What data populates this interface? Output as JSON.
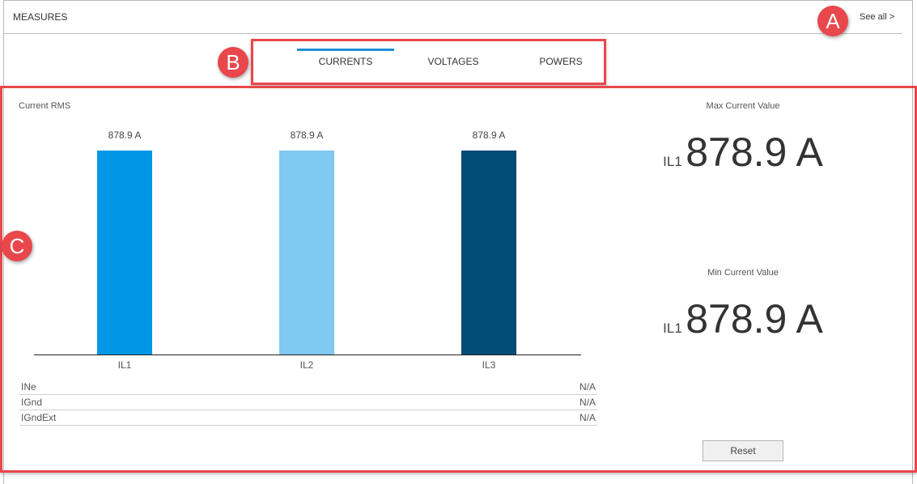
{
  "header": {
    "title": "MEASURES",
    "see_all": "See all >"
  },
  "tabs": [
    {
      "label": "CURRENTS",
      "active": true
    },
    {
      "label": "VOLTAGES",
      "active": false
    },
    {
      "label": "POWERS",
      "active": false
    }
  ],
  "annotations": {
    "a": "A",
    "b": "B",
    "c": "C"
  },
  "colors": {
    "accent": "#1e90d6",
    "annotation": "#e8474c",
    "il1": "#0096e6",
    "il2": "#80c9f0",
    "il3": "#034c77"
  },
  "chart_data": {
    "type": "bar",
    "title": "Current RMS",
    "categories": [
      "IL1",
      "IL2",
      "IL3"
    ],
    "values": [
      878.9,
      878.9,
      878.9
    ],
    "value_labels": [
      "878.9 A",
      "878.9 A",
      "878.9 A"
    ],
    "unit": "A",
    "colors": [
      "#0096e6",
      "#80c9f0",
      "#034c77"
    ],
    "xlabel": "",
    "ylabel": "",
    "ylim": [
      0,
      878.9
    ],
    "grid": false
  },
  "extra_currents": [
    {
      "label": "INe",
      "value": "N/A"
    },
    {
      "label": "IGnd",
      "value": "N/A"
    },
    {
      "label": "IGndExt",
      "value": "N/A"
    }
  ],
  "max_current": {
    "title": "Max Current Value",
    "phase": "IL1",
    "value": "878.9 A"
  },
  "min_current": {
    "title": "Min Current Value",
    "phase": "IL1",
    "value": "878.9 A"
  },
  "reset_label": "Reset"
}
